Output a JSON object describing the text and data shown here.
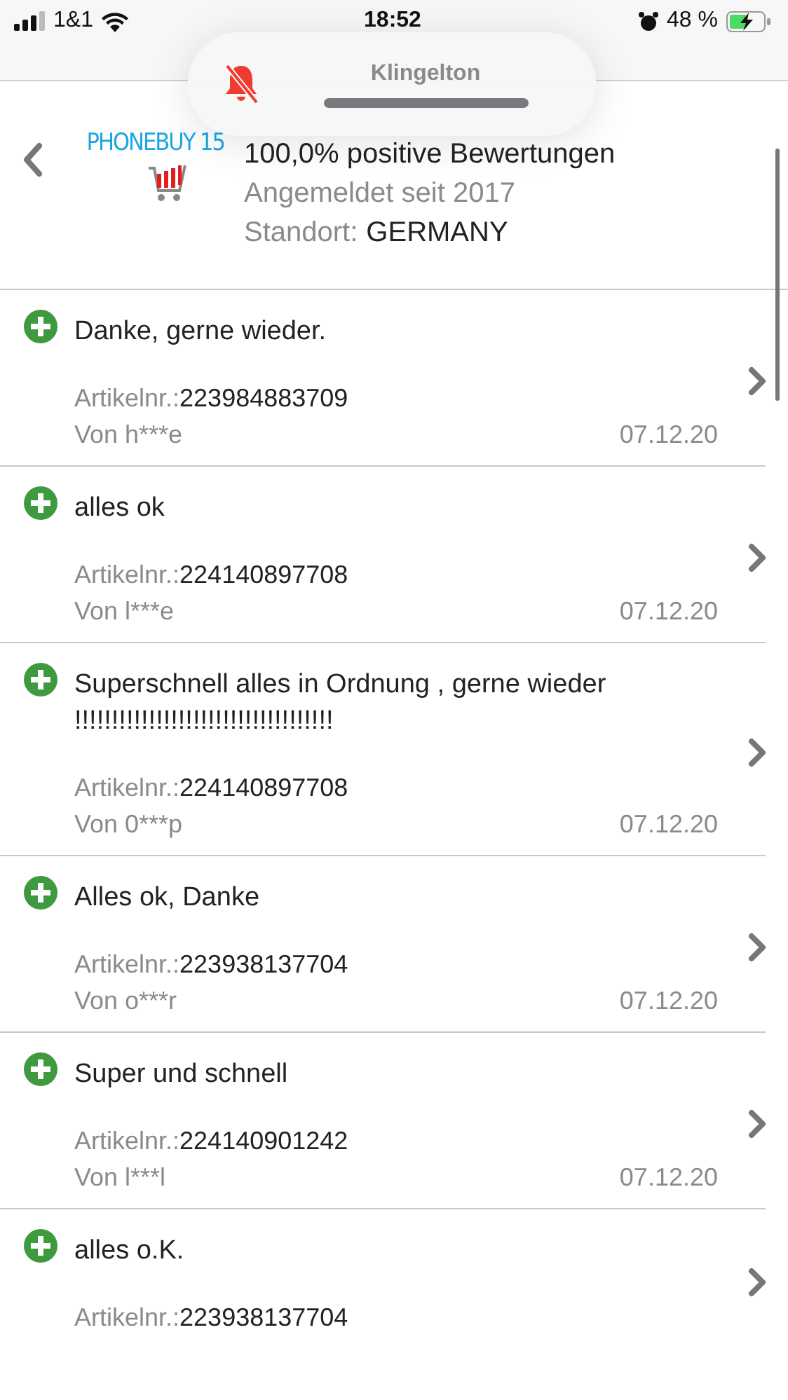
{
  "status_bar": {
    "carrier": "1&1",
    "time": "18:52",
    "battery": "48 %"
  },
  "volume_hud": {
    "title": "Klingelton",
    "muted": true,
    "level": 1
  },
  "seller": {
    "logo_text": "PHONEBUY 15",
    "rating": "100,0% positive Bewertungen",
    "member_since": "Angemeldet seit 2017",
    "location_label": "Standort:",
    "location": "GERMANY"
  },
  "reviews": [
    {
      "positive": true,
      "comment": "Danke, gerne wieder.",
      "item_label": "Artikelnr.:",
      "item_number": "223984883709",
      "author": "Von h***e",
      "date": "07.12.20"
    },
    {
      "positive": true,
      "comment": "alles ok",
      "item_label": "Artikelnr.:",
      "item_number": "224140897708",
      "author": "Von l***e",
      "date": "07.12.20"
    },
    {
      "positive": true,
      "comment": "Superschnell alles in Ordnung , gerne wieder !!!!!!!!!!!!!!!!!!!!!!!!!!!!!!!!!!!",
      "item_label": "Artikelnr.:",
      "item_number": "224140897708",
      "author": "Von 0***p",
      "date": "07.12.20"
    },
    {
      "positive": true,
      "comment": "Alles ok, Danke",
      "item_label": "Artikelnr.:",
      "item_number": "223938137704",
      "author": "Von o***r",
      "date": "07.12.20"
    },
    {
      "positive": true,
      "comment": "Super und schnell",
      "item_label": "Artikelnr.:",
      "item_number": "224140901242",
      "author": "Von l***l",
      "date": "07.12.20"
    },
    {
      "positive": true,
      "comment": "alles o.K.",
      "item_label": "Artikelnr.:",
      "item_number": "223938137704"
    }
  ]
}
